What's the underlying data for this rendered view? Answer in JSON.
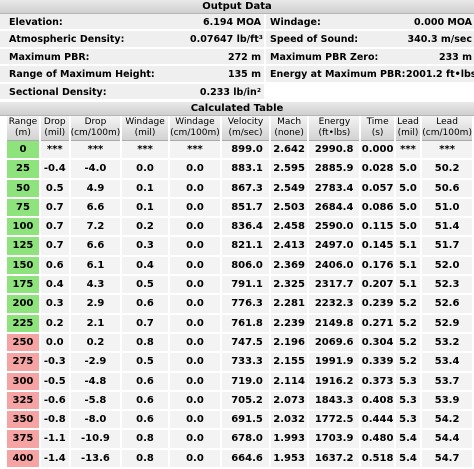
{
  "output": {
    "title": "Output Data",
    "rows": [
      {
        "l1": "Elevation:",
        "v1": "6.194 MOA",
        "l2": "Windage:",
        "v2": "0.000 MOA"
      },
      {
        "l1": "Atmospheric Density:",
        "v1": "0.07647 lb/ft³",
        "l2": "Speed of Sound:",
        "v2": "340.3 m/sec"
      },
      {
        "l1": "Maximum PBR:",
        "v1": "272 m",
        "l2": "Maximum PBR Zero:",
        "v2": "233 m"
      },
      {
        "l1": "Range of Maximum Height:",
        "v1": "135 m",
        "l2": "Energy at Maximum PBR:",
        "v2": "2001.2 ft•lbs"
      },
      {
        "l1": "Sectional Density:",
        "v1": "0.233 lb/in²",
        "l2": "",
        "v2": ""
      }
    ]
  },
  "table": {
    "title": "Calculated Table",
    "headers": [
      {
        "name": "Range",
        "unit": "(m)"
      },
      {
        "name": "Drop",
        "unit": "(mil)"
      },
      {
        "name": "Drop",
        "unit": "(cm/100m)"
      },
      {
        "name": "Windage",
        "unit": "(mil)"
      },
      {
        "name": "Windage",
        "unit": "(cm/100m)"
      },
      {
        "name": "Velocity",
        "unit": "(m/sec)"
      },
      {
        "name": "Mach",
        "unit": "(none)"
      },
      {
        "name": "Energy",
        "unit": "(ft•lbs)"
      },
      {
        "name": "Time",
        "unit": "(s)"
      },
      {
        "name": "Lead",
        "unit": "(mil)"
      },
      {
        "name": "Lead",
        "unit": "(cm/100m)"
      }
    ],
    "rows": [
      {
        "range": "0",
        "zone": "green",
        "cells": [
          "***",
          "***",
          "***",
          "***",
          "899.0",
          "2.642",
          "2990.8",
          "0.000",
          "***",
          "***"
        ]
      },
      {
        "range": "25",
        "zone": "green",
        "cells": [
          "-0.4",
          "-4.0",
          "0.0",
          "0.0",
          "883.1",
          "2.595",
          "2885.9",
          "0.028",
          "5.0",
          "50.2"
        ]
      },
      {
        "range": "50",
        "zone": "green",
        "cells": [
          "0.5",
          "4.9",
          "0.1",
          "0.0",
          "867.3",
          "2.549",
          "2783.4",
          "0.057",
          "5.0",
          "50.6"
        ]
      },
      {
        "range": "75",
        "zone": "green",
        "cells": [
          "0.7",
          "6.6",
          "0.1",
          "0.0",
          "851.7",
          "2.503",
          "2684.4",
          "0.086",
          "5.0",
          "51.0"
        ]
      },
      {
        "range": "100",
        "zone": "green",
        "cells": [
          "0.7",
          "7.2",
          "0.2",
          "0.0",
          "836.4",
          "2.458",
          "2590.0",
          "0.115",
          "5.0",
          "51.4"
        ]
      },
      {
        "range": "125",
        "zone": "green",
        "cells": [
          "0.7",
          "6.6",
          "0.3",
          "0.0",
          "821.1",
          "2.413",
          "2497.0",
          "0.145",
          "5.1",
          "51.7"
        ]
      },
      {
        "range": "150",
        "zone": "green",
        "cells": [
          "0.6",
          "6.1",
          "0.4",
          "0.0",
          "806.0",
          "2.369",
          "2406.0",
          "0.176",
          "5.1",
          "52.0"
        ]
      },
      {
        "range": "175",
        "zone": "green",
        "cells": [
          "0.4",
          "4.3",
          "0.5",
          "0.0",
          "791.1",
          "2.325",
          "2317.7",
          "0.207",
          "5.1",
          "52.3"
        ]
      },
      {
        "range": "200",
        "zone": "green",
        "cells": [
          "0.3",
          "2.9",
          "0.6",
          "0.0",
          "776.3",
          "2.281",
          "2232.3",
          "0.239",
          "5.2",
          "52.6"
        ]
      },
      {
        "range": "225",
        "zone": "green",
        "cells": [
          "0.2",
          "2.1",
          "0.7",
          "0.0",
          "761.8",
          "2.239",
          "2149.8",
          "0.271",
          "5.2",
          "52.9"
        ]
      },
      {
        "range": "250",
        "zone": "red",
        "cells": [
          "0.0",
          "0.2",
          "0.8",
          "0.0",
          "747.5",
          "2.196",
          "2069.6",
          "0.304",
          "5.2",
          "53.2"
        ]
      },
      {
        "range": "275",
        "zone": "red",
        "cells": [
          "-0.3",
          "-2.9",
          "0.5",
          "0.0",
          "733.3",
          "2.155",
          "1991.9",
          "0.339",
          "5.2",
          "53.4"
        ]
      },
      {
        "range": "300",
        "zone": "red",
        "cells": [
          "-0.5",
          "-4.8",
          "0.6",
          "0.0",
          "719.0",
          "2.114",
          "1916.2",
          "0.373",
          "5.3",
          "53.7"
        ]
      },
      {
        "range": "325",
        "zone": "red",
        "cells": [
          "-0.6",
          "-5.8",
          "0.6",
          "0.0",
          "705.2",
          "2.073",
          "1843.3",
          "0.408",
          "5.3",
          "53.9"
        ]
      },
      {
        "range": "350",
        "zone": "red",
        "cells": [
          "-0.8",
          "-8.0",
          "0.6",
          "0.0",
          "691.5",
          "2.032",
          "1772.5",
          "0.444",
          "5.3",
          "54.2"
        ]
      },
      {
        "range": "375",
        "zone": "red",
        "cells": [
          "-1.1",
          "-10.9",
          "0.8",
          "0.0",
          "678.0",
          "1.993",
          "1703.9",
          "0.480",
          "5.4",
          "54.4"
        ]
      },
      {
        "range": "400",
        "zone": "red",
        "cells": [
          "-1.4",
          "-13.6",
          "0.8",
          "0.0",
          "664.6",
          "1.953",
          "1637.2",
          "0.518",
          "5.4",
          "54.7"
        ]
      }
    ]
  }
}
